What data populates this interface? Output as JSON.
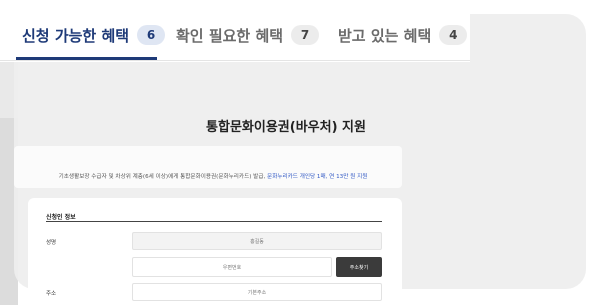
{
  "tabs": [
    {
      "label": "신청 가능한 혜택",
      "count": "6",
      "active": true
    },
    {
      "label": "확인 필요한 혜택",
      "count": "7",
      "active": false
    },
    {
      "label": "받고 있는 혜택",
      "count": "4",
      "active": false
    }
  ],
  "page": {
    "title": "통합문화이용권(바우처) 지원",
    "notice_text": "기초생활보장 수급자 및 차상위 계층(6세 이상)에게 통합문화이용권(문화누리카드) 발급,",
    "notice_link": "문화누리카드 개인당 1매, 연 13만 원 지원"
  },
  "form": {
    "section_title": "신청인 정보",
    "name_label": "성명",
    "name_value": "홍길동",
    "postcode_placeholder": "우편번호",
    "search_button": "주소찾기",
    "address_label": "주소",
    "address_placeholder": "기본주소"
  },
  "colors": {
    "accent": "#1e3a78",
    "badge_active_bg": "#dfe6f3",
    "link": "#2f57c4",
    "card_bg": "#eeeeee"
  }
}
